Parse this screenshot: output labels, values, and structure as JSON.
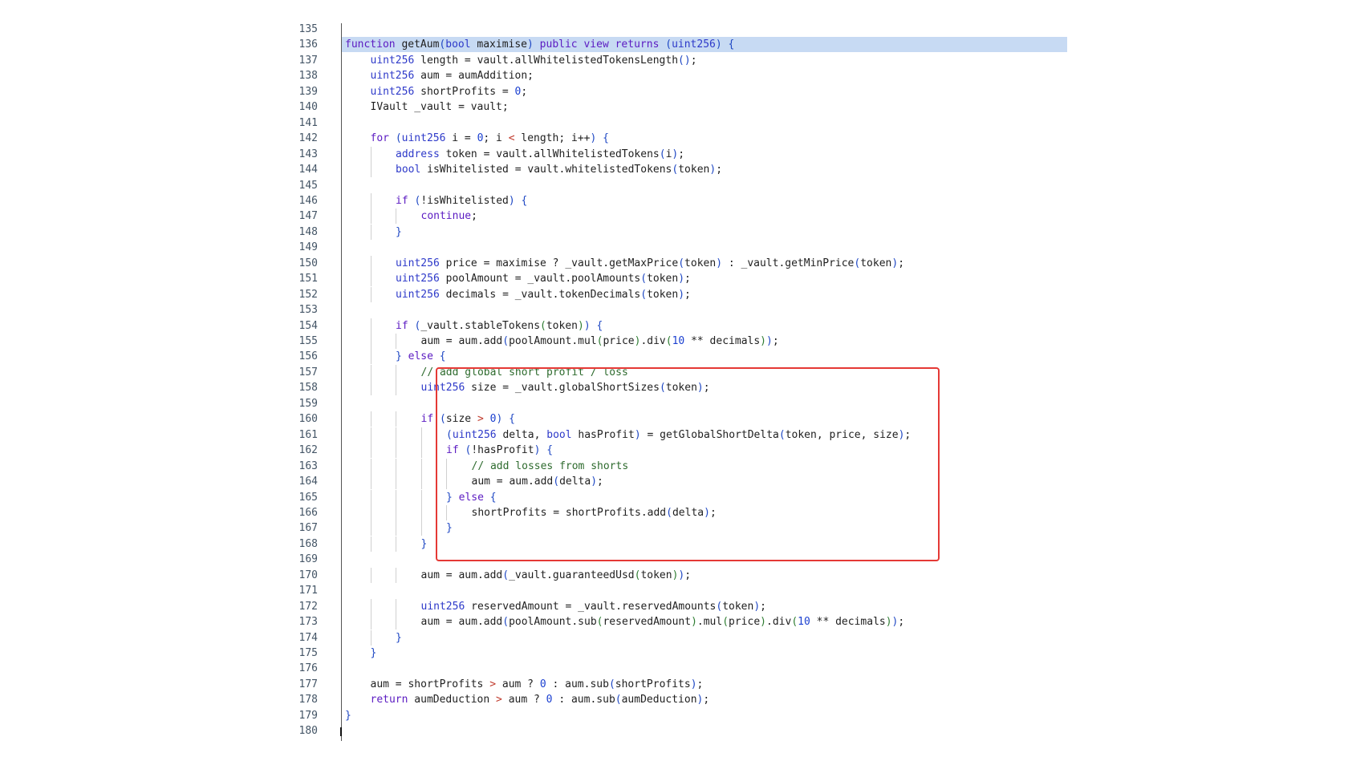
{
  "highlight_line": 136,
  "lines": [
    {
      "n": "135",
      "indent": 0,
      "t": ""
    },
    {
      "n": "136",
      "indent": 1,
      "t": "function getAum(bool maximise) public view returns (uint256) {"
    },
    {
      "n": "137",
      "indent": 2,
      "t": "uint256 length = vault.allWhitelistedTokensLength();"
    },
    {
      "n": "138",
      "indent": 2,
      "t": "uint256 aum = aumAddition;"
    },
    {
      "n": "139",
      "indent": 2,
      "t": "uint256 shortProfits = 0;"
    },
    {
      "n": "140",
      "indent": 2,
      "t": "IVault _vault = vault;"
    },
    {
      "n": "141",
      "indent": 0,
      "t": ""
    },
    {
      "n": "142",
      "indent": 2,
      "t": "for (uint256 i = 0; i < length; i++) {"
    },
    {
      "n": "143",
      "indent": 3,
      "t": "address token = vault.allWhitelistedTokens(i);"
    },
    {
      "n": "144",
      "indent": 3,
      "t": "bool isWhitelisted = vault.whitelistedTokens(token);"
    },
    {
      "n": "145",
      "indent": 0,
      "t": ""
    },
    {
      "n": "146",
      "indent": 3,
      "t": "if (!isWhitelisted) {"
    },
    {
      "n": "147",
      "indent": 4,
      "t": "continue;"
    },
    {
      "n": "148",
      "indent": 3,
      "t": "}"
    },
    {
      "n": "149",
      "indent": 0,
      "t": ""
    },
    {
      "n": "150",
      "indent": 3,
      "t": "uint256 price = maximise ? _vault.getMaxPrice(token) : _vault.getMinPrice(token);"
    },
    {
      "n": "151",
      "indent": 3,
      "t": "uint256 poolAmount = _vault.poolAmounts(token);"
    },
    {
      "n": "152",
      "indent": 3,
      "t": "uint256 decimals = _vault.tokenDecimals(token);"
    },
    {
      "n": "153",
      "indent": 0,
      "t": ""
    },
    {
      "n": "154",
      "indent": 3,
      "t": "if (_vault.stableTokens(token)) {"
    },
    {
      "n": "155",
      "indent": 4,
      "t": "aum = aum.add(poolAmount.mul(price).div(10 ** decimals));"
    },
    {
      "n": "156",
      "indent": 3,
      "t": "} else {"
    },
    {
      "n": "157",
      "indent": 4,
      "t": "// add global short profit / loss"
    },
    {
      "n": "158",
      "indent": 4,
      "t": "uint256 size = _vault.globalShortSizes(token);"
    },
    {
      "n": "159",
      "indent": 0,
      "t": ""
    },
    {
      "n": "160",
      "indent": 4,
      "t": "if (size > 0) {"
    },
    {
      "n": "161",
      "indent": 5,
      "t": "(uint256 delta, bool hasProfit) = getGlobalShortDelta(token, price, size);"
    },
    {
      "n": "162",
      "indent": 5,
      "t": "if (!hasProfit) {"
    },
    {
      "n": "163",
      "indent": 6,
      "t": "// add losses from shorts"
    },
    {
      "n": "164",
      "indent": 6,
      "t": "aum = aum.add(delta);"
    },
    {
      "n": "165",
      "indent": 5,
      "t": "} else {"
    },
    {
      "n": "166",
      "indent": 6,
      "t": "shortProfits = shortProfits.add(delta);"
    },
    {
      "n": "167",
      "indent": 5,
      "t": "}"
    },
    {
      "n": "168",
      "indent": 4,
      "t": "}"
    },
    {
      "n": "169",
      "indent": 0,
      "t": ""
    },
    {
      "n": "170",
      "indent": 4,
      "t": "aum = aum.add(_vault.guaranteedUsd(token));"
    },
    {
      "n": "171",
      "indent": 0,
      "t": ""
    },
    {
      "n": "172",
      "indent": 4,
      "t": "uint256 reservedAmount = _vault.reservedAmounts(token);"
    },
    {
      "n": "173",
      "indent": 4,
      "t": "aum = aum.add(poolAmount.sub(reservedAmount).mul(price).div(10 ** decimals));"
    },
    {
      "n": "174",
      "indent": 3,
      "t": "}"
    },
    {
      "n": "175",
      "indent": 2,
      "t": "}"
    },
    {
      "n": "176",
      "indent": 0,
      "t": ""
    },
    {
      "n": "177",
      "indent": 2,
      "t": "aum = shortProfits > aum ? 0 : aum.sub(shortProfits);"
    },
    {
      "n": "178",
      "indent": 2,
      "t": "return aumDeduction > aum ? 0 : aum.sub(aumDeduction);"
    },
    {
      "n": "179",
      "indent": 1,
      "t": "}"
    },
    {
      "n": "180",
      "indent": 0,
      "t": ""
    }
  ]
}
